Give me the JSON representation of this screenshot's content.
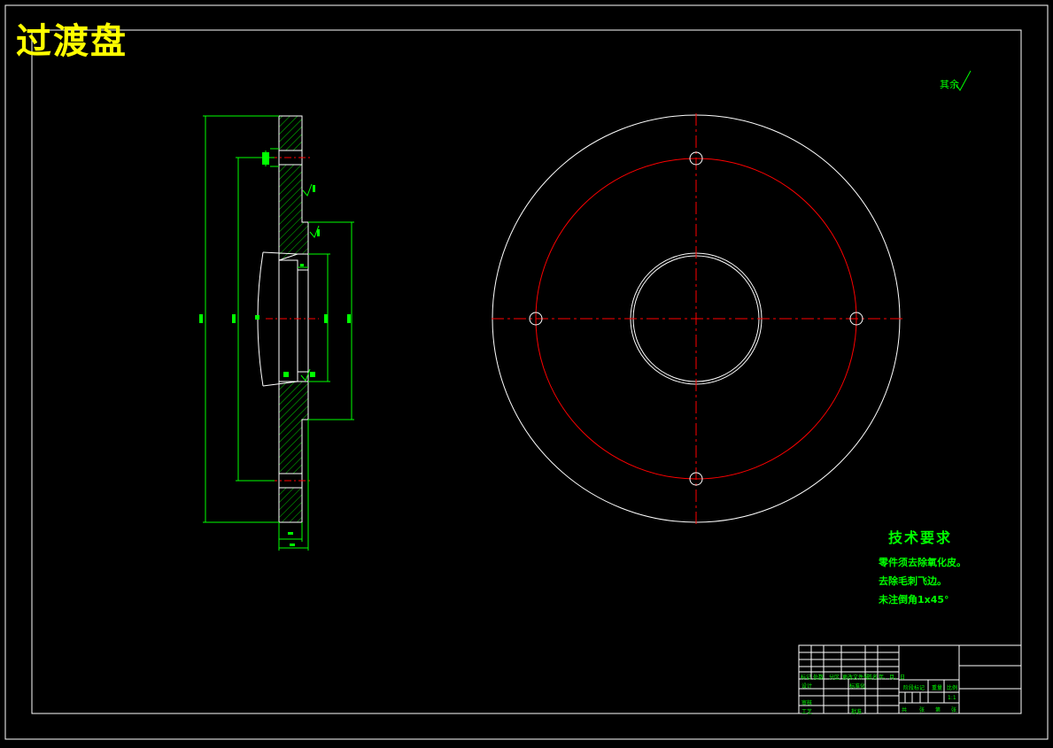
{
  "title": "过渡盘",
  "roughness_note": "其余",
  "tech_requirements": {
    "heading": "技术要求",
    "lines": [
      "零件须去除氧化皮。",
      "去除毛刺飞边。",
      "未注倒角1x45°"
    ]
  },
  "title_block": {
    "row_labels": [
      "标记",
      "处数",
      "分区",
      "更改文件号",
      "签名",
      "年、月、日"
    ],
    "design": "设计",
    "standardization": "标准化",
    "review": "审核",
    "process": "工艺",
    "approve": "批准",
    "stage_mark": "阶段标记",
    "weight": "重量",
    "scale": "比例",
    "scale_value": "1:1",
    "sheets": [
      "共",
      "张",
      "第",
      "张"
    ]
  },
  "colors": {
    "background": "#000000",
    "outline": "#ffffff",
    "centerline": "#ff0000",
    "dimension": "#00ff00",
    "title": "#ffff00"
  }
}
